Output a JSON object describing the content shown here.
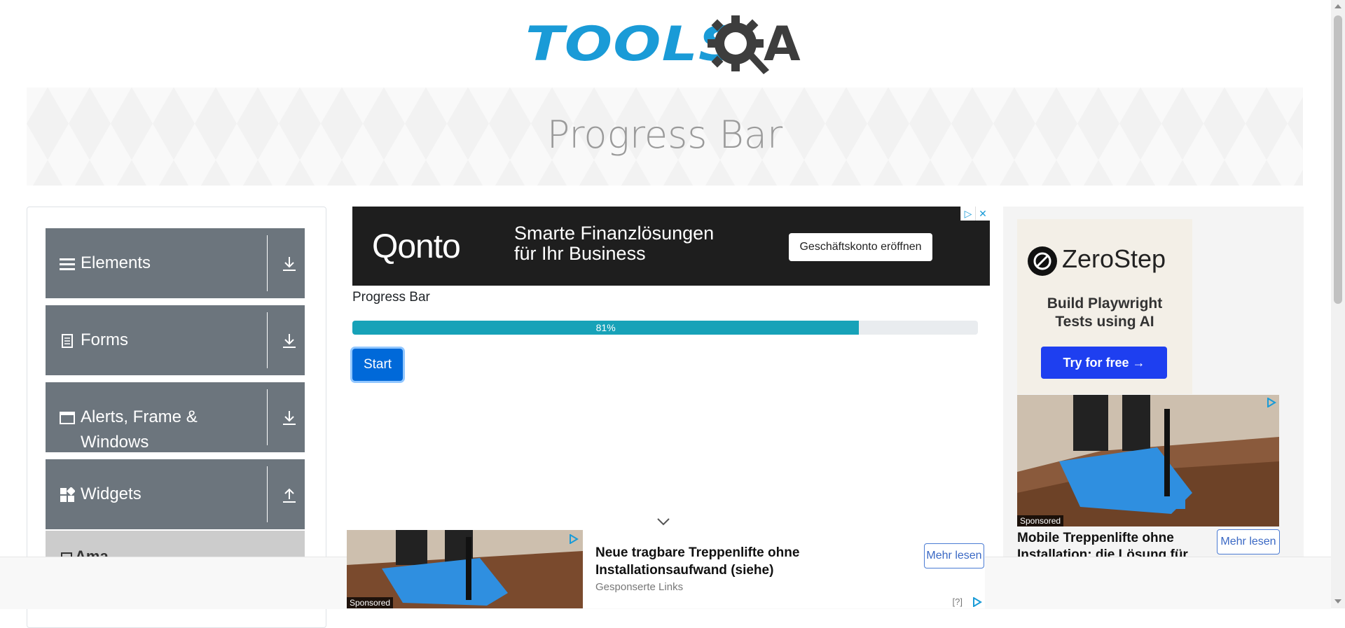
{
  "logo": {
    "text": "TOOLS",
    "suffix": "A"
  },
  "banner": {
    "title": "Progress Bar"
  },
  "sidebar": {
    "groups": [
      {
        "label": "Elements",
        "icon": "list-icon",
        "arrow": "download-arrow-icon"
      },
      {
        "label": "Forms",
        "icon": "document-icon",
        "arrow": "download-arrow-icon"
      },
      {
        "label": "Alerts, Frame & Windows",
        "icon": "window-icon",
        "arrow": "download-arrow-icon"
      },
      {
        "label": "Widgets",
        "icon": "widgets-icon",
        "arrow": "upload-arrow-icon"
      },
      {
        "label": "Ama...",
        "icon": "book-icon"
      }
    ]
  },
  "ad_top": {
    "brand": "Qonto",
    "text_line1": "Smarte Finanzlösungen",
    "text_line2": "für Ihr Business",
    "cta": "Geschäftskonto eröffnen"
  },
  "main": {
    "label": "Progress Bar",
    "progress": {
      "value": 81,
      "text": "81%"
    },
    "start_button": "Start"
  },
  "ad_right": {
    "brand": "ZeroStep",
    "text_line1": "Build Playwright",
    "text_line2": "Tests using AI",
    "cta": "Try for free →",
    "sponsored": "Sponsored",
    "headline": "Mobile Treppenlifte ohne Installation: die Lösung für",
    "button": "Mehr lesen"
  },
  "ad_bottom": {
    "sponsored": "Sponsored",
    "headline": "Neue tragbare Treppenlifte ohne Installationsaufwand (siehe)",
    "sub": "Gesponserte Links",
    "button": "Mehr lesen",
    "help": "[?]"
  },
  "colors": {
    "accent": "#17a2b8",
    "primary": "#0069d9",
    "sidebar_group": "#6c757d",
    "logo_blue": "#1a9bd7"
  }
}
